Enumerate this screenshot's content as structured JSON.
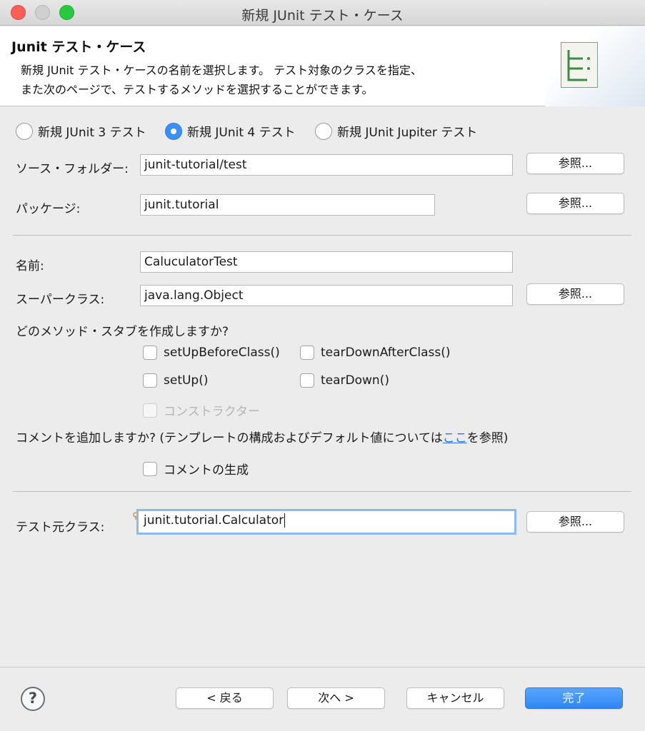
{
  "window": {
    "title": "新規 JUnit テスト・ケース"
  },
  "header": {
    "title": "Junit テスト・ケース",
    "desc_line1": "新規 JUnit テスト・ケースの名前を選択します。 テスト対象のクラスを指定、",
    "desc_line2": "また次のページで、テストするメソッドを選択することができます。",
    "icon": "junit-wizard-icon"
  },
  "radios": [
    {
      "label": "新規 JUnit 3 テスト",
      "selected": false
    },
    {
      "label": "新規 JUnit 4 テスト",
      "selected": true
    },
    {
      "label": "新規 JUnit Jupiter テスト",
      "selected": false
    }
  ],
  "form": {
    "source_folder": {
      "label": "ソース・フォルダー:",
      "value": "junit-tutorial/test"
    },
    "package": {
      "label": "パッケージ:",
      "value": "junit.tutorial"
    },
    "name": {
      "label": "名前:",
      "value": "CaluculatorTest"
    },
    "superclass": {
      "label": "スーパークラス:",
      "value": "java.lang.Object"
    },
    "browse_label": "参照..."
  },
  "stubs": {
    "question": "どのメソッド・スタブを作成しますか?",
    "items": [
      {
        "label": "setUpBeforeClass()",
        "checked": false
      },
      {
        "label": "tearDownAfterClass()",
        "checked": false
      },
      {
        "label": "setUp()",
        "checked": false
      },
      {
        "label": "tearDown()",
        "checked": false
      },
      {
        "label": "コンストラクター",
        "checked": false,
        "disabled": true
      }
    ]
  },
  "comments": {
    "question_pre": "コメントを追加しますか? (テンプレートの構成およびデフォルト値については",
    "link": "ここ",
    "question_post": "を参照)",
    "generate_label": "コメントの生成",
    "generate_checked": false
  },
  "class_under_test": {
    "label": "テスト元クラス:",
    "value": "junit.tutorial.Calculator"
  },
  "footer": {
    "help": "?",
    "back": "< 戻る",
    "next": "次へ >",
    "cancel": "キャンセル",
    "finish": "完了"
  },
  "colors": {
    "accent": "#3b8ff5",
    "link": "#2f6fd6",
    "close": "#ff5f57",
    "maximize": "#28c940"
  }
}
